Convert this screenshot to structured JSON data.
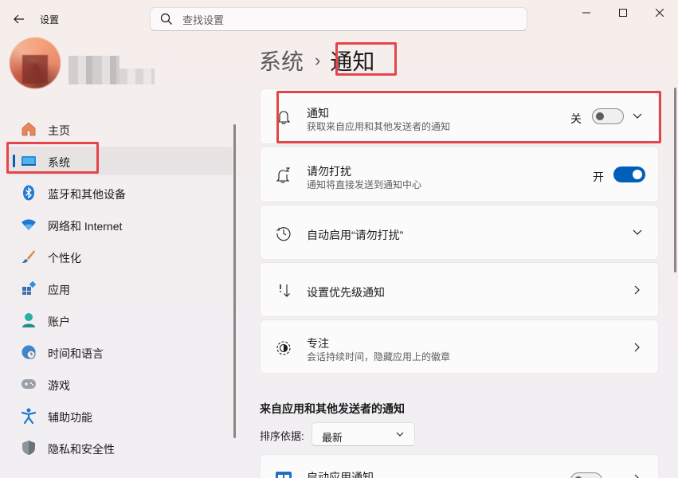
{
  "window": {
    "app_title": "设置",
    "minimize_icon": "minimize-icon",
    "maximize_icon": "maximize-icon",
    "close_icon": "close-icon"
  },
  "search": {
    "placeholder": "查找设置",
    "value": ""
  },
  "sidebar": {
    "items": [
      {
        "label": "主页",
        "icon": "home-icon"
      },
      {
        "label": "系统",
        "icon": "system-icon",
        "selected": true
      },
      {
        "label": "蓝牙和其他设备",
        "icon": "bluetooth-icon"
      },
      {
        "label": "网络和 Internet",
        "icon": "wifi-icon"
      },
      {
        "label": "个性化",
        "icon": "brush-icon"
      },
      {
        "label": "应用",
        "icon": "apps-icon"
      },
      {
        "label": "账户",
        "icon": "account-icon"
      },
      {
        "label": "时间和语言",
        "icon": "time-language-icon"
      },
      {
        "label": "游戏",
        "icon": "gamepad-icon"
      },
      {
        "label": "辅助功能",
        "icon": "accessibility-icon"
      },
      {
        "label": "隐私和安全性",
        "icon": "shield-icon"
      }
    ]
  },
  "breadcrumb": {
    "parent": "系统",
    "separator": "›",
    "current": "通知"
  },
  "cards": {
    "notifications": {
      "title": "通知",
      "subtitle": "获取来自应用和其他发送者的通知",
      "toggle_label": "关",
      "toggle_on": false
    },
    "dnd": {
      "title": "请勿打扰",
      "subtitle": "通知将直接发送到通知中心",
      "toggle_label": "开",
      "toggle_on": true
    },
    "auto_dnd": {
      "title": "自动启用“请勿打扰”"
    },
    "priority": {
      "title": "设置优先级通知"
    },
    "focus": {
      "title": "专注",
      "subtitle": "会话持续时间，隐藏应用上的徽章"
    },
    "startup": {
      "title": "启动应用通知"
    }
  },
  "section": {
    "title": "来自应用和其他发送者的通知",
    "sort_label": "排序依据:",
    "sort_value": "最新"
  },
  "colors": {
    "accent": "#005fb8",
    "highlight": "#e5444a"
  }
}
